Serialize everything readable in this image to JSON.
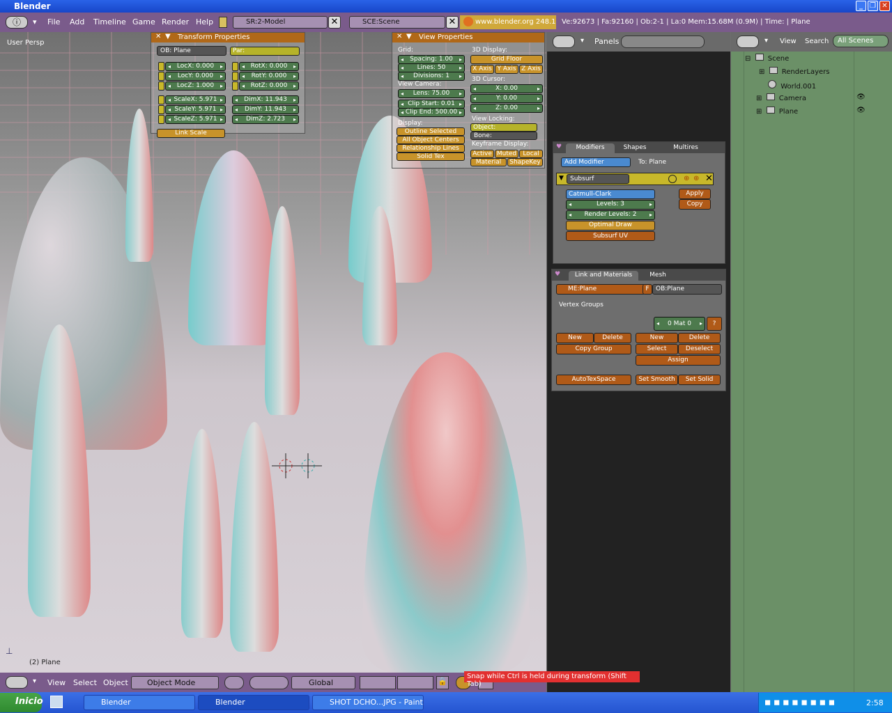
{
  "window": {
    "title": "Blender"
  },
  "menu": {
    "items": [
      "File",
      "Add",
      "Timeline",
      "Game",
      "Render",
      "Help"
    ]
  },
  "screen_field": "SR:2-Model",
  "scene_field": "SCE:Scene",
  "site": "www.blender.org 248.1",
  "stats": "Ve:92673 | Fa:92160 | Ob:2-1 | La:0   Mem:15.68M (0.9M) | Time: | Plane",
  "viewport": {
    "label": "User Persp",
    "object_label": "(2) Plane"
  },
  "transform": {
    "title": "Transform Properties",
    "ob_name": "OB: Plane",
    "par_name": "Par:",
    "loc": [
      "LocX: 0.000",
      "LocY: 0.000",
      "LocZ: 1.000"
    ],
    "rot": [
      "RotX: 0.000",
      "RotY: 0.000",
      "RotZ: 0.000"
    ],
    "scale": [
      "ScaleX: 5.971",
      "ScaleY: 5.971",
      "ScaleZ: 5.971"
    ],
    "dim": [
      "DimX: 11.943",
      "DimY: 11.943",
      "DimZ: 2.723"
    ],
    "link_scale": "Link Scale"
  },
  "view_props": {
    "title": "View Properties",
    "grid_label": "Grid:",
    "spacing": "Spacing: 1.00",
    "lines": "Lines: 50",
    "divisions": "Divisions: 1",
    "camera_label": "View Camera:",
    "lens": "Lens: 75.00",
    "clip_start": "Clip Start: 0.01",
    "clip_end": "Clip End: 500.00",
    "display_label": "Display:",
    "display_btns": [
      "Outline Selected",
      "All Object Centers",
      "Relationship Lines",
      "Solid Tex"
    ],
    "d3_label": "3D Display:",
    "grid_floor": "Grid Floor",
    "axes": [
      "X Axis",
      "Y Axis",
      "Z Axis"
    ],
    "cursor_label": "3D Cursor:",
    "cursor": [
      "X: 0.00",
      "Y: 0.00",
      "Z: 0.00"
    ],
    "locking_label": "View Locking:",
    "object_field": "Object:",
    "bone_field": "Bone:",
    "keyframe_label": "Keyframe Display:",
    "kf_btns": [
      "Active",
      "Muted",
      "Local"
    ],
    "kf_btns2": [
      "Material",
      "ShapeKey"
    ]
  },
  "props_header": {
    "panels": "Panels"
  },
  "modifiers": {
    "tabs": [
      "Modifiers",
      "Shapes",
      "Multires"
    ],
    "add_modifier": "Add Modifier",
    "to": "To: Plane",
    "mod_name": "Subsurf",
    "type": "Catmull-Clark",
    "levels": "Levels: 3",
    "render_levels": "Render Levels: 2",
    "optimal": "Optimal Draw",
    "subsurf_uv": "Subsurf UV",
    "apply": "Apply",
    "copy": "Copy"
  },
  "link": {
    "tabs": [
      "Link and Materials",
      "Mesh"
    ],
    "me": "ME:Plane",
    "f": "F",
    "ob": "OB:Plane",
    "vgroups": "Vertex Groups",
    "mat": "0 Mat 0",
    "q": "?",
    "new": "New",
    "delete": "Delete",
    "copy_group": "Copy Group",
    "new2": "New",
    "delete2": "Delete",
    "select": "Select",
    "deselect": "Deselect",
    "assign": "Assign",
    "autotex": "AutoTexSpace",
    "set_smooth": "Set Smooth",
    "set_solid": "Set Solid"
  },
  "outliner": {
    "header": [
      "View",
      "Search",
      "All Scenes"
    ],
    "items": [
      "Scene",
      "RenderLayers",
      "World.001",
      "Camera",
      "Plane"
    ]
  },
  "bottom": {
    "menus": [
      "View",
      "Select",
      "Object"
    ],
    "mode": "Object Mode",
    "orient": "Global",
    "tooltip": "Snap while Ctrl is held during transform (Shift Tab)"
  },
  "taskbar": {
    "start": "Inicio",
    "tasks": [
      "Blender",
      "Blender",
      "SHOT DCHO...JPG - Paint"
    ],
    "clock": "2:58"
  }
}
